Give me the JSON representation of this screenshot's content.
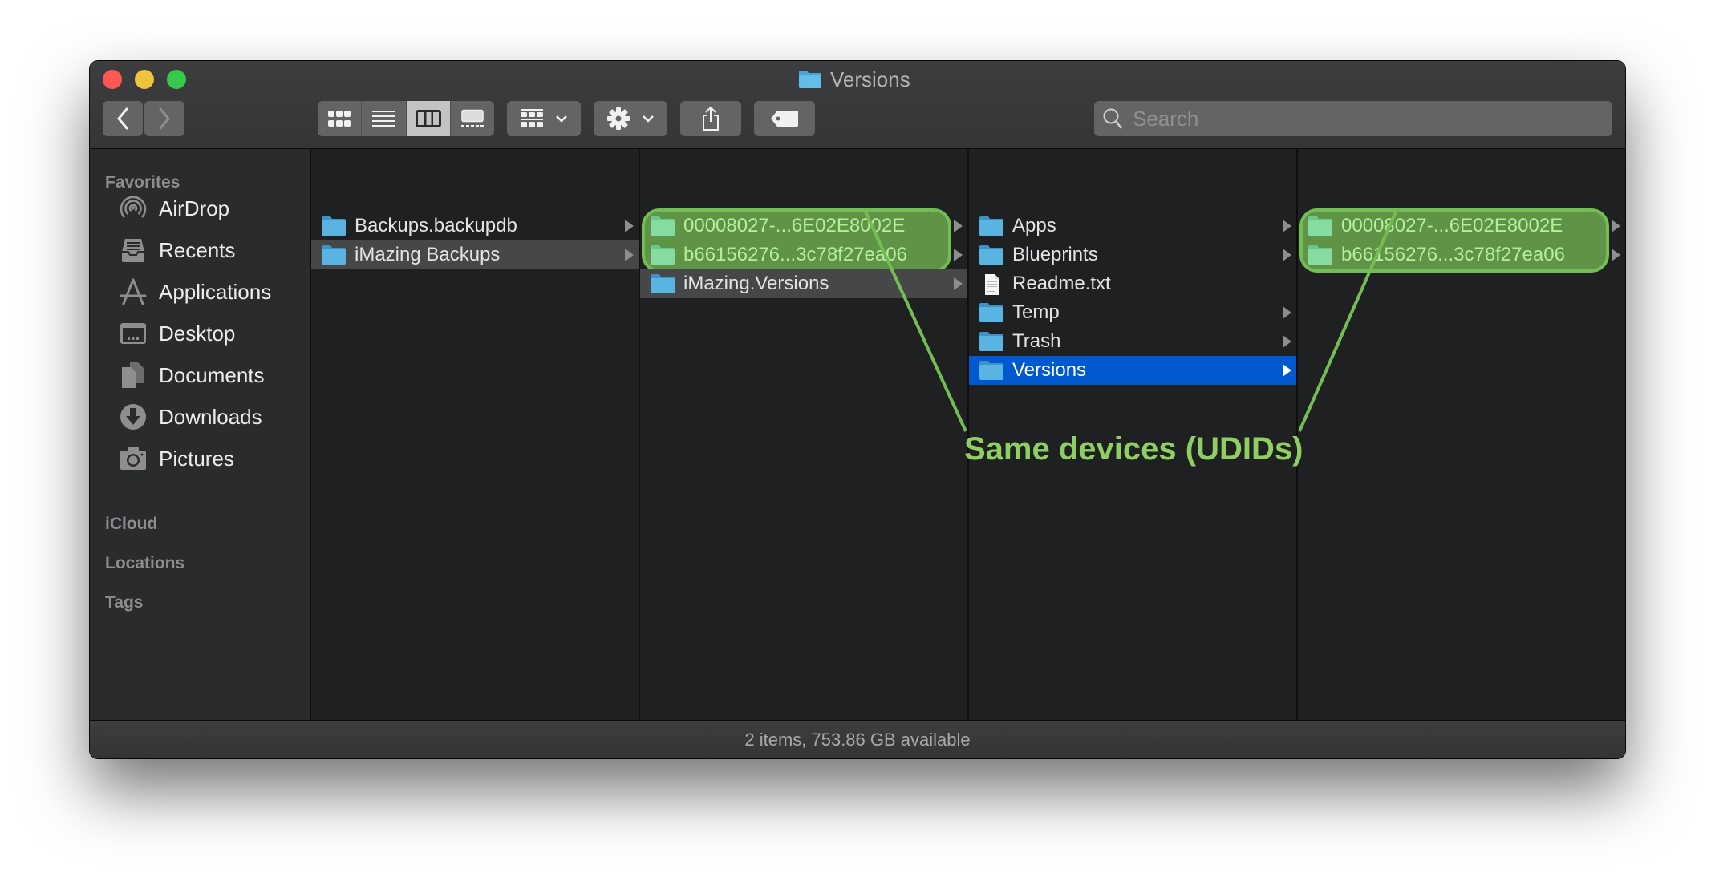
{
  "window": {
    "title": "Versions",
    "title_icon": "folder-icon"
  },
  "toolbar": {
    "back_icon": "chevron-left-icon",
    "forward_icon": "chevron-right-icon",
    "view_modes": [
      {
        "name": "icon-view",
        "icon": "grid-icon",
        "active": false
      },
      {
        "name": "list-view",
        "icon": "list-icon",
        "active": false
      },
      {
        "name": "column-view",
        "icon": "columns-icon",
        "active": true
      },
      {
        "name": "gallery-view",
        "icon": "gallery-icon",
        "active": false
      }
    ],
    "group_icon": "group-by-icon",
    "action_icon": "gear-icon",
    "share_icon": "share-icon",
    "tag_icon": "tag-icon",
    "search_placeholder": "Search"
  },
  "sidebar": {
    "sections": {
      "favorites": "Favorites",
      "icloud": "iCloud",
      "locations": "Locations",
      "tags": "Tags"
    },
    "items": [
      {
        "label": "AirDrop",
        "icon": "airdrop-icon"
      },
      {
        "label": "Recents",
        "icon": "recents-icon"
      },
      {
        "label": "Applications",
        "icon": "applications-icon"
      },
      {
        "label": "Desktop",
        "icon": "desktop-icon"
      },
      {
        "label": "Documents",
        "icon": "documents-icon"
      },
      {
        "label": "Downloads",
        "icon": "downloads-icon"
      },
      {
        "label": "Pictures",
        "icon": "pictures-icon"
      }
    ]
  },
  "columns": [
    {
      "items": [
        {
          "name": "Backups.backupdb",
          "type": "folder",
          "has_children": true,
          "state": "none"
        },
        {
          "name": "iMazing Backups",
          "type": "folder",
          "has_children": true,
          "state": "selected-inactive"
        }
      ]
    },
    {
      "items": [
        {
          "name": "00008027-...6E02E8002E",
          "type": "folder",
          "has_children": true,
          "state": "highlighted"
        },
        {
          "name": "b66156276...3c78f27ea06",
          "type": "folder",
          "has_children": true,
          "state": "highlighted"
        },
        {
          "name": "iMazing.Versions",
          "type": "folder",
          "has_children": true,
          "state": "selected-inactive"
        }
      ]
    },
    {
      "items": [
        {
          "name": "Apps",
          "type": "folder",
          "has_children": true,
          "state": "none"
        },
        {
          "name": "Blueprints",
          "type": "folder",
          "has_children": true,
          "state": "none"
        },
        {
          "name": "Readme.txt",
          "type": "file",
          "has_children": false,
          "state": "none"
        },
        {
          "name": "Temp",
          "type": "folder",
          "has_children": true,
          "state": "none"
        },
        {
          "name": "Trash",
          "type": "folder",
          "has_children": true,
          "state": "none"
        },
        {
          "name": "Versions",
          "type": "folder",
          "has_children": true,
          "state": "selected"
        }
      ]
    },
    {
      "items": [
        {
          "name": "00008027-...6E02E8002E",
          "type": "folder",
          "has_children": true,
          "state": "highlighted"
        },
        {
          "name": "b66156276...3c78f27ea06",
          "type": "folder",
          "has_children": true,
          "state": "highlighted"
        }
      ]
    }
  ],
  "status_bar": {
    "text": "2 items, 753.86 GB available"
  },
  "annotation": {
    "text": "Same devices (UDIDs)",
    "color": "#8fcf62"
  },
  "colors": {
    "selection_blue": "#0059cf",
    "highlight_green": "#74bd55",
    "folder_blue": "#5ab4e2"
  }
}
